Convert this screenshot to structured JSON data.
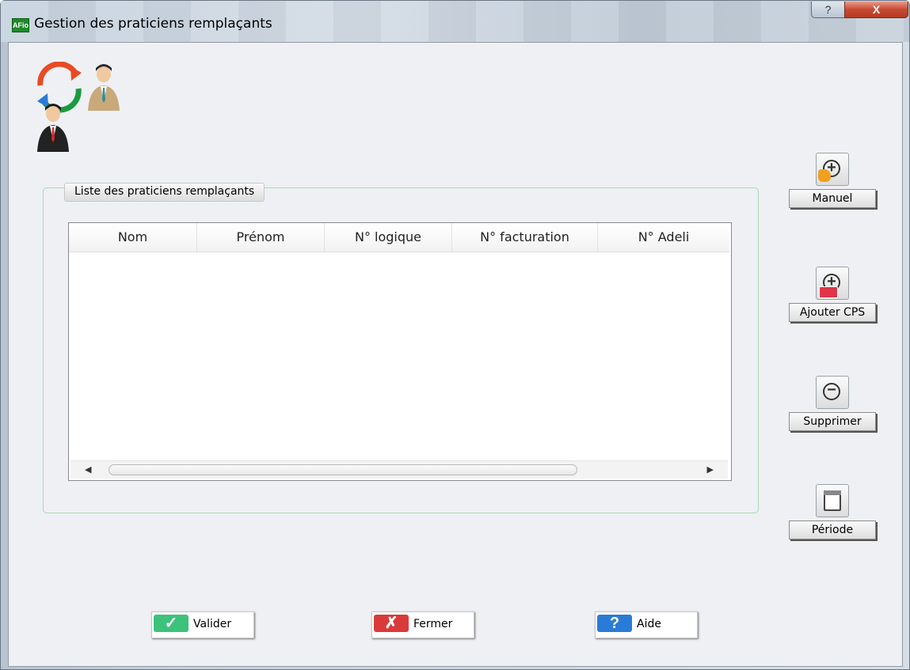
{
  "window": {
    "title": "Gestion des praticiens remplaçants",
    "app_icon_text": "AFio",
    "help_glyph": "?",
    "close_glyph": "X"
  },
  "group": {
    "label": "Liste des praticiens remplaçants"
  },
  "list": {
    "columns": [
      "Nom",
      "Prénom",
      "N° logique",
      "N° facturation",
      "N° Adeli"
    ],
    "rows": []
  },
  "side_buttons": {
    "manual": {
      "label": "Manuel",
      "icon": "plus-hand-icon"
    },
    "add_cps": {
      "label": "Ajouter CPS",
      "icon": "plus-card-icon"
    },
    "delete": {
      "label": "Supprimer",
      "icon": "minus-icon"
    },
    "period": {
      "label": "Période",
      "icon": "calendar-icon"
    }
  },
  "bottom_buttons": {
    "validate": {
      "label": "Valider",
      "color": "#3cc27a"
    },
    "close": {
      "label": "Fermer",
      "color": "#d93a3a"
    },
    "help": {
      "label": "Aide",
      "color": "#2a7bd6"
    }
  }
}
